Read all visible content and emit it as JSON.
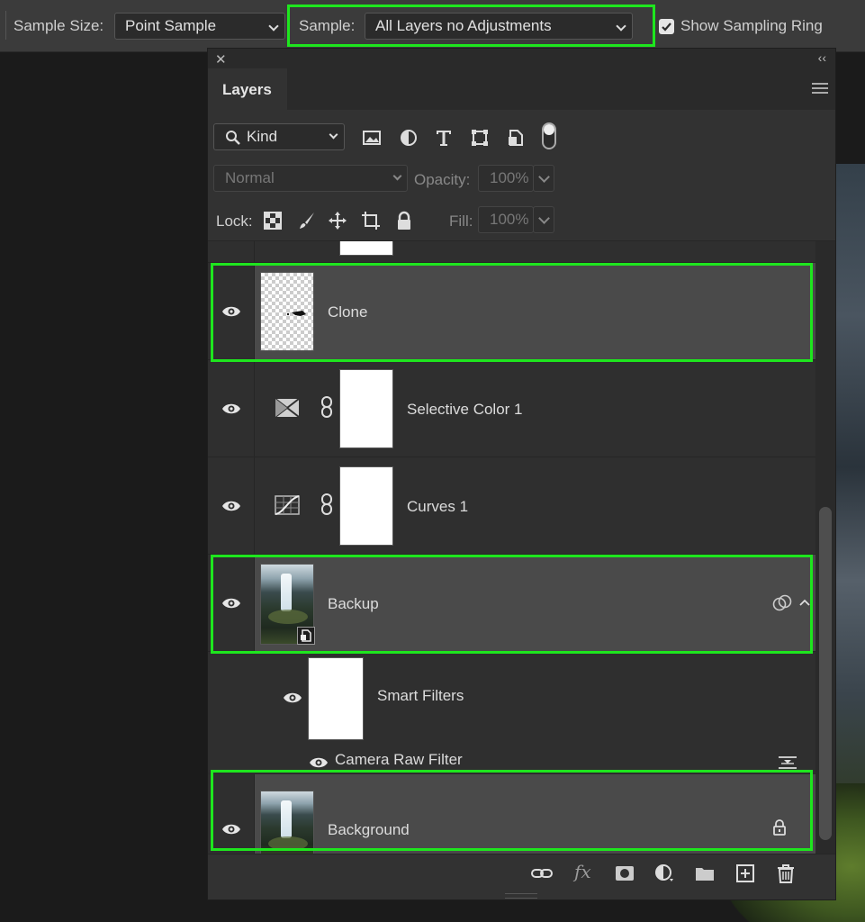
{
  "options_bar": {
    "sample_size_label": "Sample Size:",
    "sample_size_value": "Point Sample",
    "sample_label": "Sample:",
    "sample_value": "All Layers no Adjustments",
    "sampling_ring_label": "Show Sampling Ring",
    "sampling_ring_checked": true
  },
  "panel": {
    "tab_label": "Layers",
    "filter_kind_label": "Kind",
    "blend_mode": "Normal",
    "opacity_label": "Opacity:",
    "opacity_value": "100%",
    "lock_label": "Lock:",
    "fill_label": "Fill:",
    "fill_value": "100%"
  },
  "layers": [
    {
      "name": "Clone",
      "type": "pixel",
      "visible": true,
      "highlighted": true
    },
    {
      "name": "Selective Color 1",
      "type": "adjustment-selective-color",
      "visible": true,
      "highlighted": false
    },
    {
      "name": "Curves 1",
      "type": "adjustment-curves",
      "visible": true,
      "highlighted": false
    },
    {
      "name": "Backup",
      "type": "smart-object",
      "visible": true,
      "highlighted": true
    },
    {
      "name": "Smart Filters",
      "type": "smart-filters",
      "visible": true,
      "highlighted": false
    },
    {
      "name": "Camera Raw Filter",
      "type": "filter",
      "visible": true,
      "highlighted": false
    },
    {
      "name": "Background",
      "type": "background",
      "visible": true,
      "highlighted": true,
      "locked": true
    }
  ],
  "bottom_toolbar_icons": [
    "link-icon",
    "fx-icon",
    "mask-icon",
    "adjustment-icon",
    "folder-icon",
    "new-layer-icon",
    "trash-icon"
  ],
  "bottom_toolbar": {
    "fx_label": "fx"
  },
  "colors": {
    "highlight": "#1ee61e",
    "panel_bg": "#323232",
    "selected_row": "#4a4a4a"
  }
}
